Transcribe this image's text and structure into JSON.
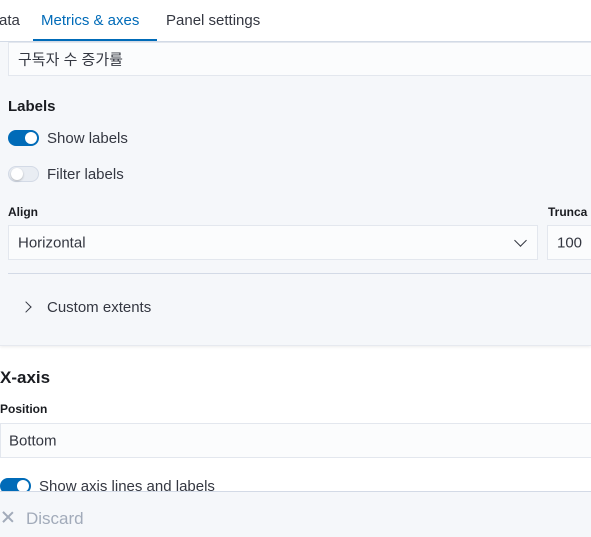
{
  "tabs": [
    {
      "label": "ata"
    },
    {
      "label": "Metrics & axes"
    },
    {
      "label": "Panel settings"
    }
  ],
  "metric_title_input": {
    "value": "구독자 수 증가률"
  },
  "labels_section": {
    "title": "Labels",
    "show_labels": {
      "label": "Show labels",
      "on": true
    },
    "filter_labels": {
      "label": "Filter labels",
      "on": false
    },
    "align": {
      "label": "Align",
      "value": "Horizontal"
    },
    "truncate": {
      "label": "Trunca",
      "value": "100"
    }
  },
  "custom_extents": {
    "label": "Custom extents"
  },
  "x_axis": {
    "title": "X-axis",
    "position": {
      "label": "Position",
      "value": "Bottom"
    },
    "show_axis_lines": {
      "label": "Show axis lines and labels",
      "on": true
    }
  },
  "footer": {
    "discard_label": "Discard"
  },
  "colors": {
    "accent": "#006bb8",
    "panel_bg": "#f5f7fa",
    "border": "#d3dae6"
  }
}
